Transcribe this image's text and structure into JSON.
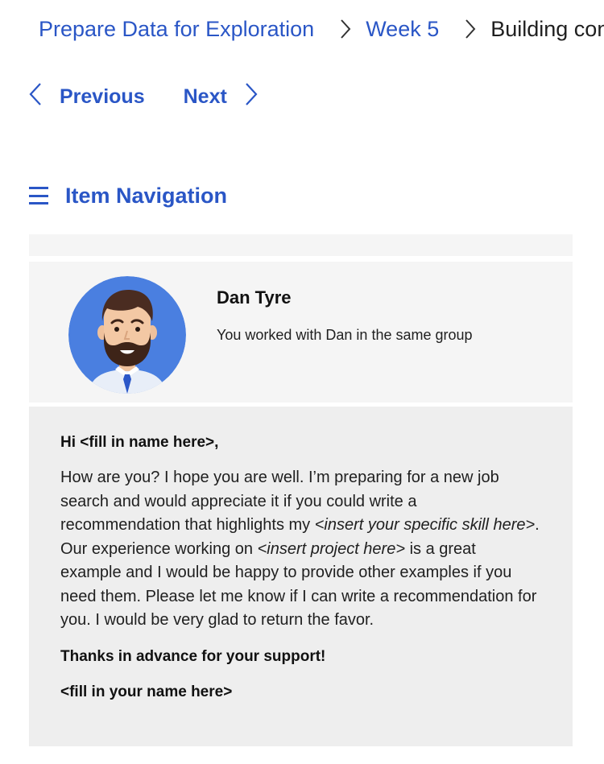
{
  "breadcrumb": {
    "course": "Prepare Data for Exploration",
    "week": "Week 5",
    "current": "Building con"
  },
  "nav": {
    "previous_label": "Previous",
    "next_label": "Next"
  },
  "item_navigation": {
    "label": "Item Navigation"
  },
  "profile": {
    "name": "Dan Tyre",
    "relationship": "You worked with Dan in the same group"
  },
  "letter": {
    "greeting": "Hi <fill in name here>,",
    "body": {
      "part1": "How are you? I hope you are well. I’m preparing for a new job search and would appreciate it if you could write a recommendation that highlights my ",
      "skill_placeholder": "<insert your specific skill here>",
      "part2": ". Our experience working on ",
      "project_placeholder": "<insert project here>",
      "part3": " is a great example and I would be happy to provide other examples if you need them. Please let me know if I can write a recommendation for you. I would be very glad to return the favor."
    },
    "closing": "Thanks in advance for your support!",
    "signature": "<fill in your name here>"
  },
  "colors": {
    "link_blue": "#2a56c6",
    "avatar_bg": "#4a7fe0",
    "card_bg": "#f5f5f5",
    "letter_bg": "#eeeeee"
  }
}
